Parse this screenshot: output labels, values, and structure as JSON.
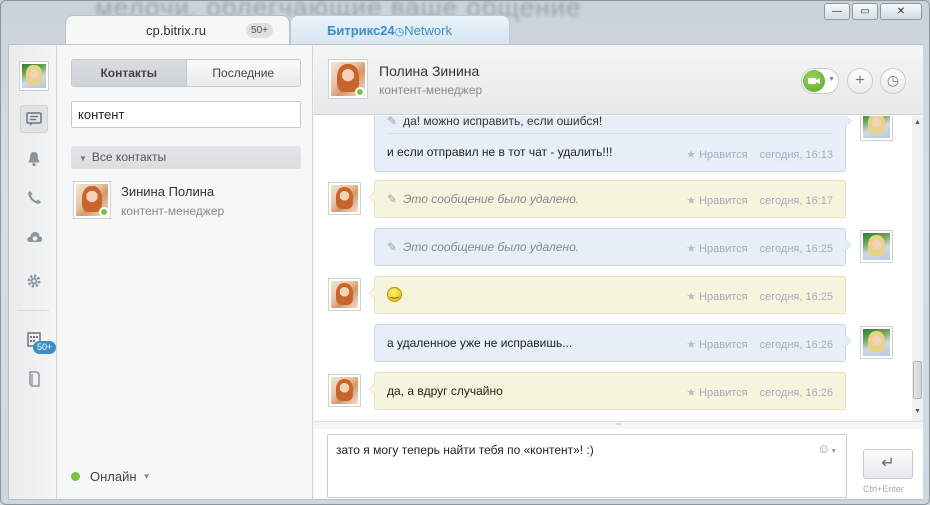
{
  "window": {
    "bg_text": "мелочи, облегчающие ваше общение",
    "buttons": [
      "—",
      "▭",
      "✕"
    ]
  },
  "tabs": [
    {
      "label": "cp.bitrix.ru",
      "badge": "50+"
    },
    {
      "label": "Битрикс24",
      "suffix": "Network"
    }
  ],
  "iconbar": {
    "badge": "50+"
  },
  "contacts_panel": {
    "segments": [
      "Контакты",
      "Последние"
    ],
    "search_value": "контент",
    "group": "Все контакты",
    "contact": {
      "name": "Зинина Полина",
      "role": "контент-менеджер"
    },
    "status": "Онлайн"
  },
  "chat": {
    "header": {
      "name": "Полина Зинина",
      "role": "контент-менеджер"
    },
    "like_label": "Нравится",
    "messages": [
      {
        "dir": "out",
        "text": "да! можно исправить, если ошибся!",
        "text2": "и если отправил не в тот чат - удалить!!!",
        "time": "сегодня, 16:13"
      },
      {
        "dir": "in",
        "text": "Это сообщение было удалено.",
        "time": "сегодня, 16:17"
      },
      {
        "dir": "out",
        "text": "Это сообщение было удалено.",
        "time": "сегодня, 16:25"
      },
      {
        "dir": "in",
        "text": "",
        "time": "сегодня, 16:25"
      },
      {
        "dir": "out",
        "text": "а удаленное уже не исправишь...",
        "time": "сегодня, 16:26"
      },
      {
        "dir": "in",
        "text": "да, а вдруг случайно",
        "time": "сегодня, 16:26"
      }
    ],
    "composer_value": "зато я могу теперь найти тебя по «контент»! :)",
    "send_hint": "Ctrl+Enter"
  }
}
